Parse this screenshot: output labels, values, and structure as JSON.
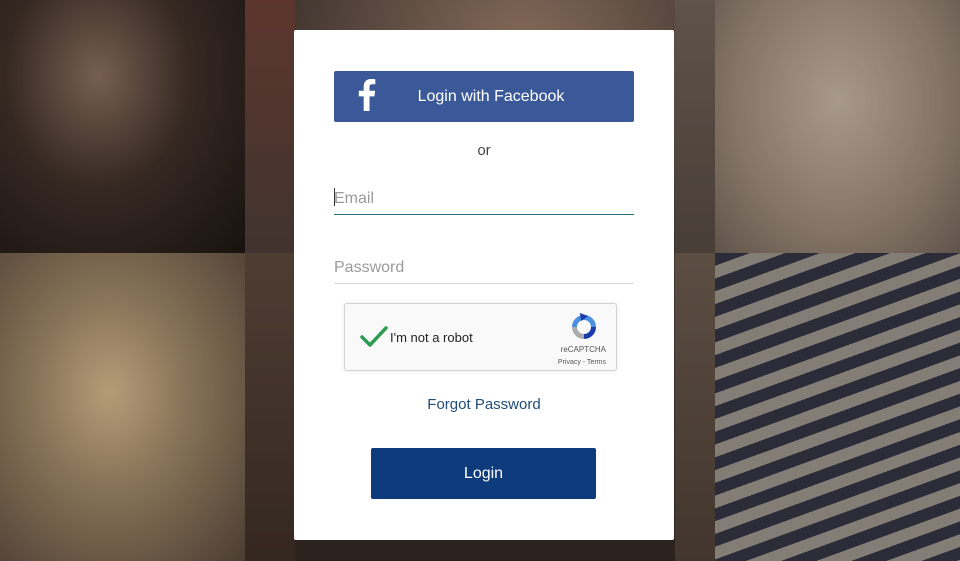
{
  "login": {
    "facebook_button_label": "Login with Facebook",
    "divider_text": "or",
    "email_placeholder": "Email",
    "email_value": "",
    "password_placeholder": "Password",
    "password_value": "",
    "forgot_password_label": "Forgot Password",
    "submit_label": "Login"
  },
  "recaptcha": {
    "label": "I'm not a robot",
    "checked": true,
    "brand": "reCAPTCHA",
    "links": "Privacy - Terms"
  },
  "colors": {
    "facebook_blue": "#3b5998",
    "login_button": "#0e3b7b",
    "link": "#1f4c78",
    "check_green": "#2e9b54"
  }
}
